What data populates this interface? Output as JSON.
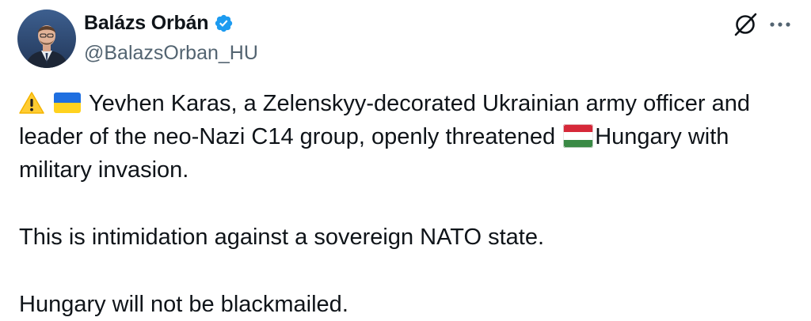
{
  "author": {
    "display_name": "Balázs Orbán",
    "handle": "@BalazsOrban_HU",
    "verified_icon": "verified-badge-icon",
    "avatar_icon": "profile-photo"
  },
  "actions": {
    "grok_icon": "grok-icon",
    "more_icon": "more-options-icon"
  },
  "body": {
    "line1_text": "Yevhen Karas, a Zelenskyy-decorated Ukrainian army officer and",
    "line2_before_flag": "leader of the neo-Nazi C14 group, openly threatened ",
    "line2_after_flag": "Hungary with",
    "line3_text": "military invasion.",
    "paragraph2": "This is intimidation against a sovereign NATO state.",
    "paragraph3": "Hungary will not be blackmailed.",
    "emojis": [
      "warning-emoji",
      "ukraine-flag-emoji",
      "hungary-flag-emoji"
    ]
  },
  "colors": {
    "text": "#0f1419",
    "secondary": "#536471",
    "verified_blue": "#1d9bf0"
  }
}
